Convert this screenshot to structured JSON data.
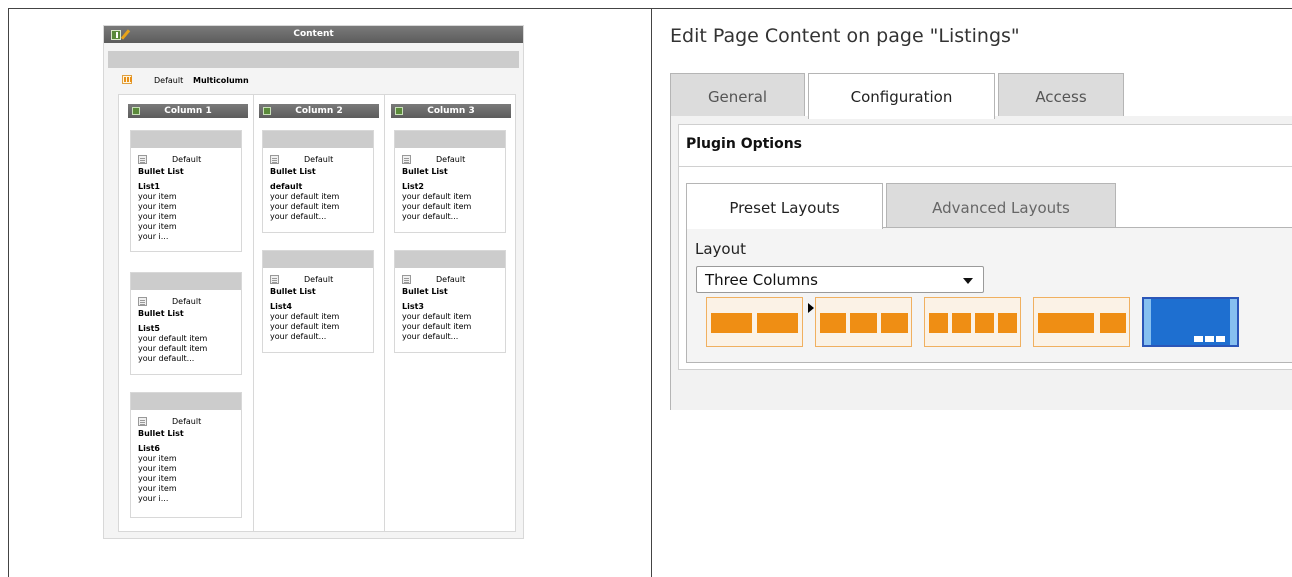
{
  "page_module": {
    "header_title": "Content",
    "multicolumn_language": "Default",
    "multicolumn_type": "Multicolumn",
    "columns": [
      {
        "label": "Column 1"
      },
      {
        "label": "Column 2"
      },
      {
        "label": "Column 3"
      }
    ],
    "elements": [
      {
        "language": "Default",
        "ctype": "Bullet List",
        "header": "List1",
        "body": "your item\nyour item\nyour item\nyour item\nyour i..."
      },
      {
        "language": "Default",
        "ctype": "Bullet List",
        "header": "List5",
        "body": "your default item\nyour default item\nyour default..."
      },
      {
        "language": "Default",
        "ctype": "Bullet List",
        "header": "List6",
        "body": "your item\nyour item\nyour item\nyour item\nyour i..."
      },
      {
        "language": "Default",
        "ctype": "Bullet List",
        "header": "default",
        "body": "your default item\nyour default item\nyour default..."
      },
      {
        "language": "Default",
        "ctype": "Bullet List",
        "header": "List4",
        "body": "your default item\nyour default item\nyour default..."
      },
      {
        "language": "Default",
        "ctype": "Bullet List",
        "header": "List2",
        "body": "your default item\nyour default item\nyour default..."
      },
      {
        "language": "Default",
        "ctype": "Bullet List",
        "header": "List3",
        "body": "your default item\nyour default item\nyour default..."
      }
    ]
  },
  "edit_form": {
    "title": "Edit Page Content on page \"Listings\"",
    "tabs": [
      {
        "label": "General"
      },
      {
        "label": "Configuration"
      },
      {
        "label": "Access"
      }
    ],
    "section_title": "Plugin Options",
    "subtabs": [
      {
        "label": "Preset Layouts"
      },
      {
        "label": "Advanced Layouts"
      }
    ],
    "layout_label": "Layout",
    "layout_value": "Three Columns",
    "layout_options": [
      {
        "icon": "two-column-layout-icon"
      },
      {
        "icon": "three-column-layout-icon"
      },
      {
        "icon": "four-column-layout-icon"
      },
      {
        "icon": "wide-narrow-layout-icon"
      },
      {
        "icon": "advanced-layout-icon",
        "selected": true
      }
    ],
    "colors": {
      "accent_orange": "#ef8e14",
      "selected_blue": "#1e6fd0",
      "tab_inactive": "#dcdcdc"
    }
  }
}
